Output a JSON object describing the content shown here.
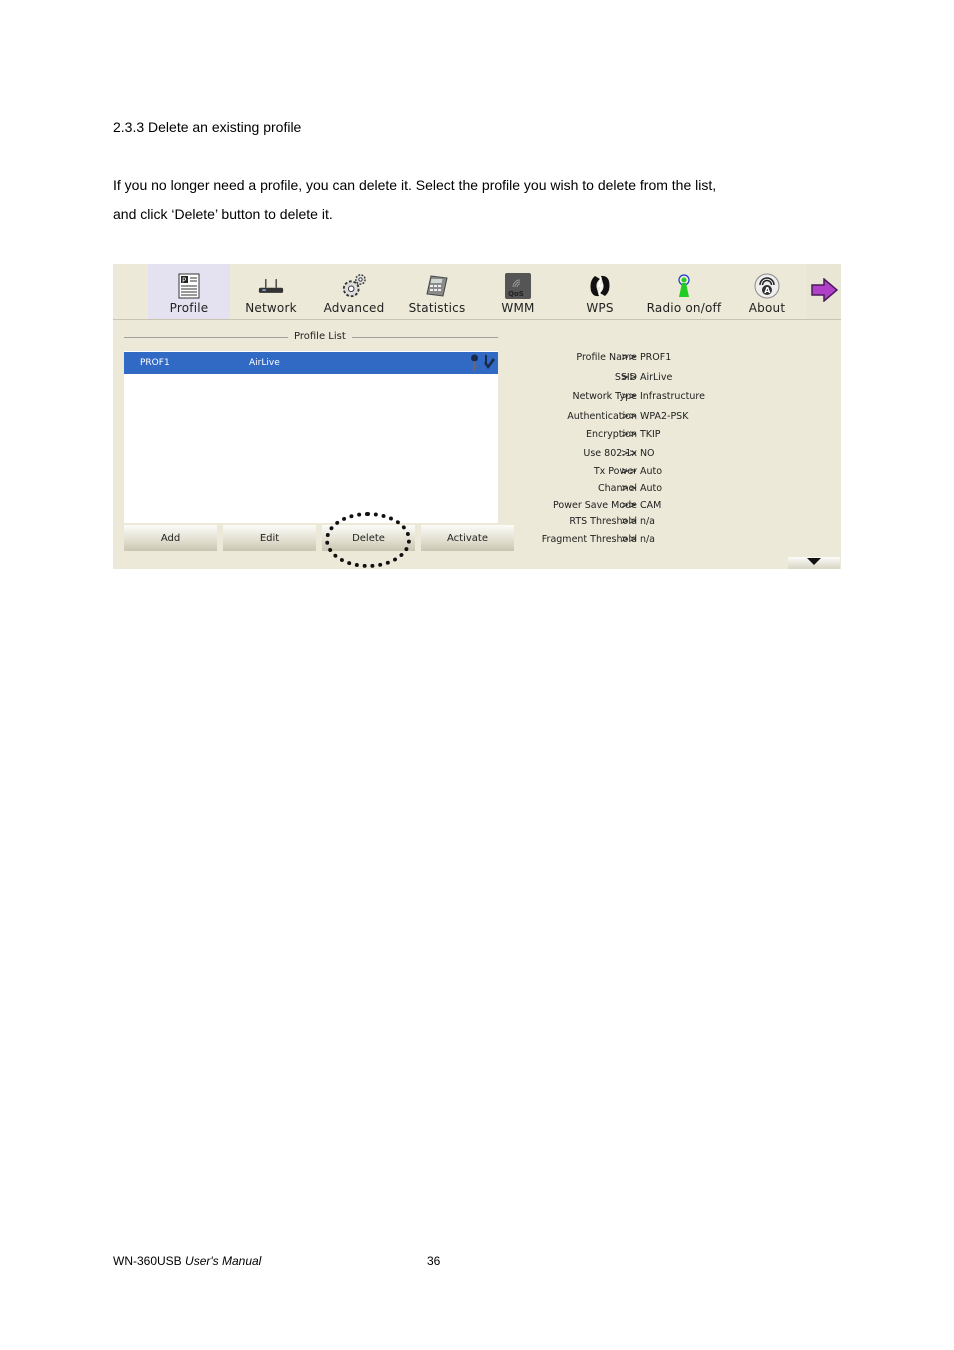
{
  "document": {
    "heading": "2.3.3 Delete an existing profile",
    "paragraph_line1": "If you no longer need a profile, you can delete it. Select the profile you wish to delete from the list,",
    "paragraph_line2": "and click ‘Delete’ button to delete it.",
    "footer_model": "WN-360USB",
    "footer_manual": "User's Manual",
    "page_number": "36"
  },
  "utility": {
    "toolbar": [
      {
        "label": "Profile",
        "icon": "profile-icon",
        "active": true
      },
      {
        "label": "Network",
        "icon": "network-router-icon"
      },
      {
        "label": "Advanced",
        "icon": "gears-icon"
      },
      {
        "label": "Statistics",
        "icon": "calculator-icon"
      },
      {
        "label": "WMM",
        "icon": "qos-icon"
      },
      {
        "label": "WPS",
        "icon": "wps-icon"
      },
      {
        "label": "Radio on/off",
        "icon": "radio-antenna-icon"
      },
      {
        "label": "About",
        "icon": "about-icon"
      }
    ],
    "next_icon": "arrow-right-icon",
    "profile_list": {
      "title": "Profile List",
      "rows": [
        {
          "name": "PROF1",
          "ssid": "AirLive",
          "selected": true,
          "icons": [
            "key-icon",
            "active-check-icon"
          ]
        }
      ]
    },
    "buttons": {
      "add": "Add",
      "edit": "Edit",
      "delete": "Delete",
      "activate": "Activate"
    },
    "details": [
      {
        "key": "Profile Name",
        "sep": ">>",
        "value": "PROF1"
      },
      {
        "key": "SSID",
        "sep": ">>",
        "value": "AirLive"
      },
      {
        "key": "Network Type",
        "sep": ">>",
        "value": "Infrastructure"
      },
      {
        "key": "Authentication",
        "sep": ">>",
        "value": "WPA2-PSK"
      },
      {
        "key": "Encryption",
        "sep": ">>",
        "value": "TKIP"
      },
      {
        "key": "Use 802.1x",
        "sep": ">>",
        "value": "NO"
      },
      {
        "key": "Tx Power",
        "sep": ">>",
        "value": "Auto"
      },
      {
        "key": "Channel",
        "sep": ">>",
        "value": "Auto"
      },
      {
        "key": "Power Save Mode",
        "sep": ">>",
        "value": "CAM"
      },
      {
        "key": "RTS Threshold",
        "sep": ">>",
        "value": "n/a"
      },
      {
        "key": "Fragment Threshold",
        "sep": ">>",
        "value": "n/a"
      }
    ],
    "colors": {
      "selection": "#316ac5",
      "panel_bg": "#ece9d8",
      "active_tab_bg": "#e4e2f0"
    }
  }
}
